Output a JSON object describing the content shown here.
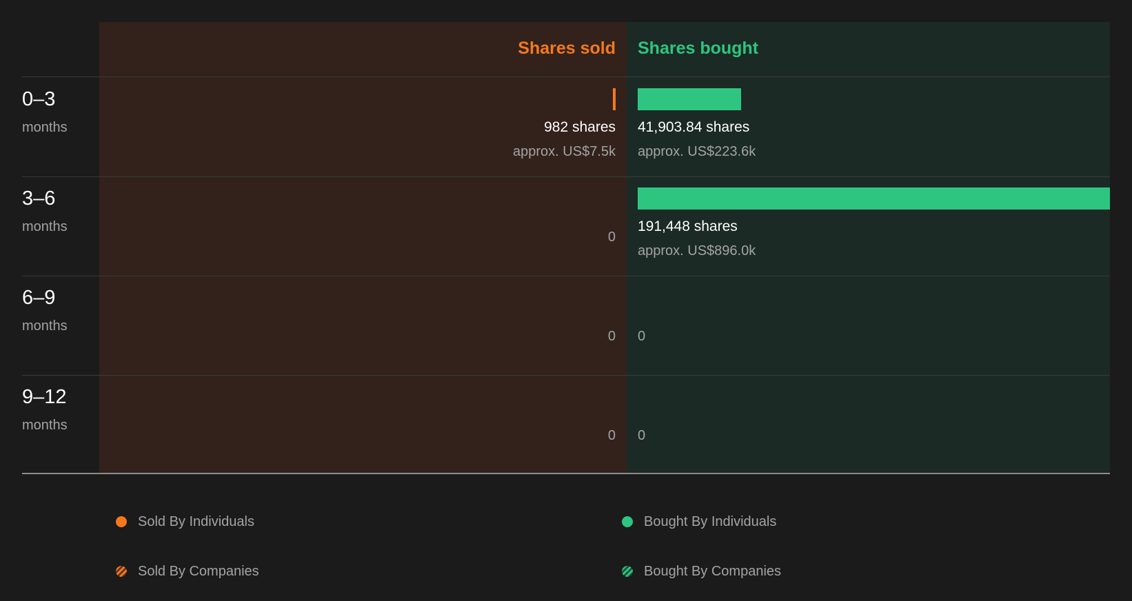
{
  "colors": {
    "sold": "#f5781f",
    "bought": "#2dc580",
    "background": "#1b1b1b",
    "sold_panel": "#32221b",
    "bought_panel": "#1b2a24",
    "text_primary": "#ffffff",
    "text_secondary": "#a4a4a4"
  },
  "headers": {
    "sold": "Shares sold",
    "bought": "Shares bought"
  },
  "chart_data": {
    "type": "bar",
    "orientation": "horizontal-diverging",
    "categories": [
      "0–3 months",
      "3–6 months",
      "6–9 months",
      "9–12 months"
    ],
    "series": [
      {
        "name": "Shares sold",
        "values": [
          982,
          0,
          0,
          0
        ]
      },
      {
        "name": "Shares bought",
        "values": [
          41903.84,
          191448,
          0,
          0
        ]
      }
    ],
    "rows": [
      {
        "range": "0–3",
        "unit": "months",
        "sold": {
          "value": 982,
          "shares_label": "982 shares",
          "value_label": "approx. US$7.5k",
          "zero_label": ""
        },
        "bought": {
          "value": 41903.84,
          "shares_label": "41,903.84 shares",
          "value_label": "approx. US$223.6k",
          "zero_label": ""
        }
      },
      {
        "range": "3–6",
        "unit": "months",
        "sold": {
          "value": 0,
          "shares_label": "",
          "value_label": "",
          "zero_label": "0"
        },
        "bought": {
          "value": 191448,
          "shares_label": "191,448 shares",
          "value_label": "approx. US$896.0k",
          "zero_label": ""
        }
      },
      {
        "range": "6–9",
        "unit": "months",
        "sold": {
          "value": 0,
          "shares_label": "",
          "value_label": "",
          "zero_label": "0"
        },
        "bought": {
          "value": 0,
          "shares_label": "",
          "value_label": "",
          "zero_label": "0"
        }
      },
      {
        "range": "9–12",
        "unit": "months",
        "sold": {
          "value": 0,
          "shares_label": "",
          "value_label": "",
          "zero_label": "0"
        },
        "bought": {
          "value": 0,
          "shares_label": "",
          "value_label": "",
          "zero_label": "0"
        }
      }
    ],
    "xlim": [
      0,
      191448
    ],
    "grid": false,
    "legend_position": "bottom"
  },
  "legend": [
    {
      "label": "Sold By Individuals",
      "icon": "solid-dot",
      "color": "#f5781f"
    },
    {
      "label": "Bought By Individuals",
      "icon": "solid-dot",
      "color": "#2dc580"
    },
    {
      "label": "Sold By Companies",
      "icon": "hatched-dot",
      "color": "#f5781f"
    },
    {
      "label": "Bought By Companies",
      "icon": "hatched-dot",
      "color": "#2dc580"
    }
  ]
}
